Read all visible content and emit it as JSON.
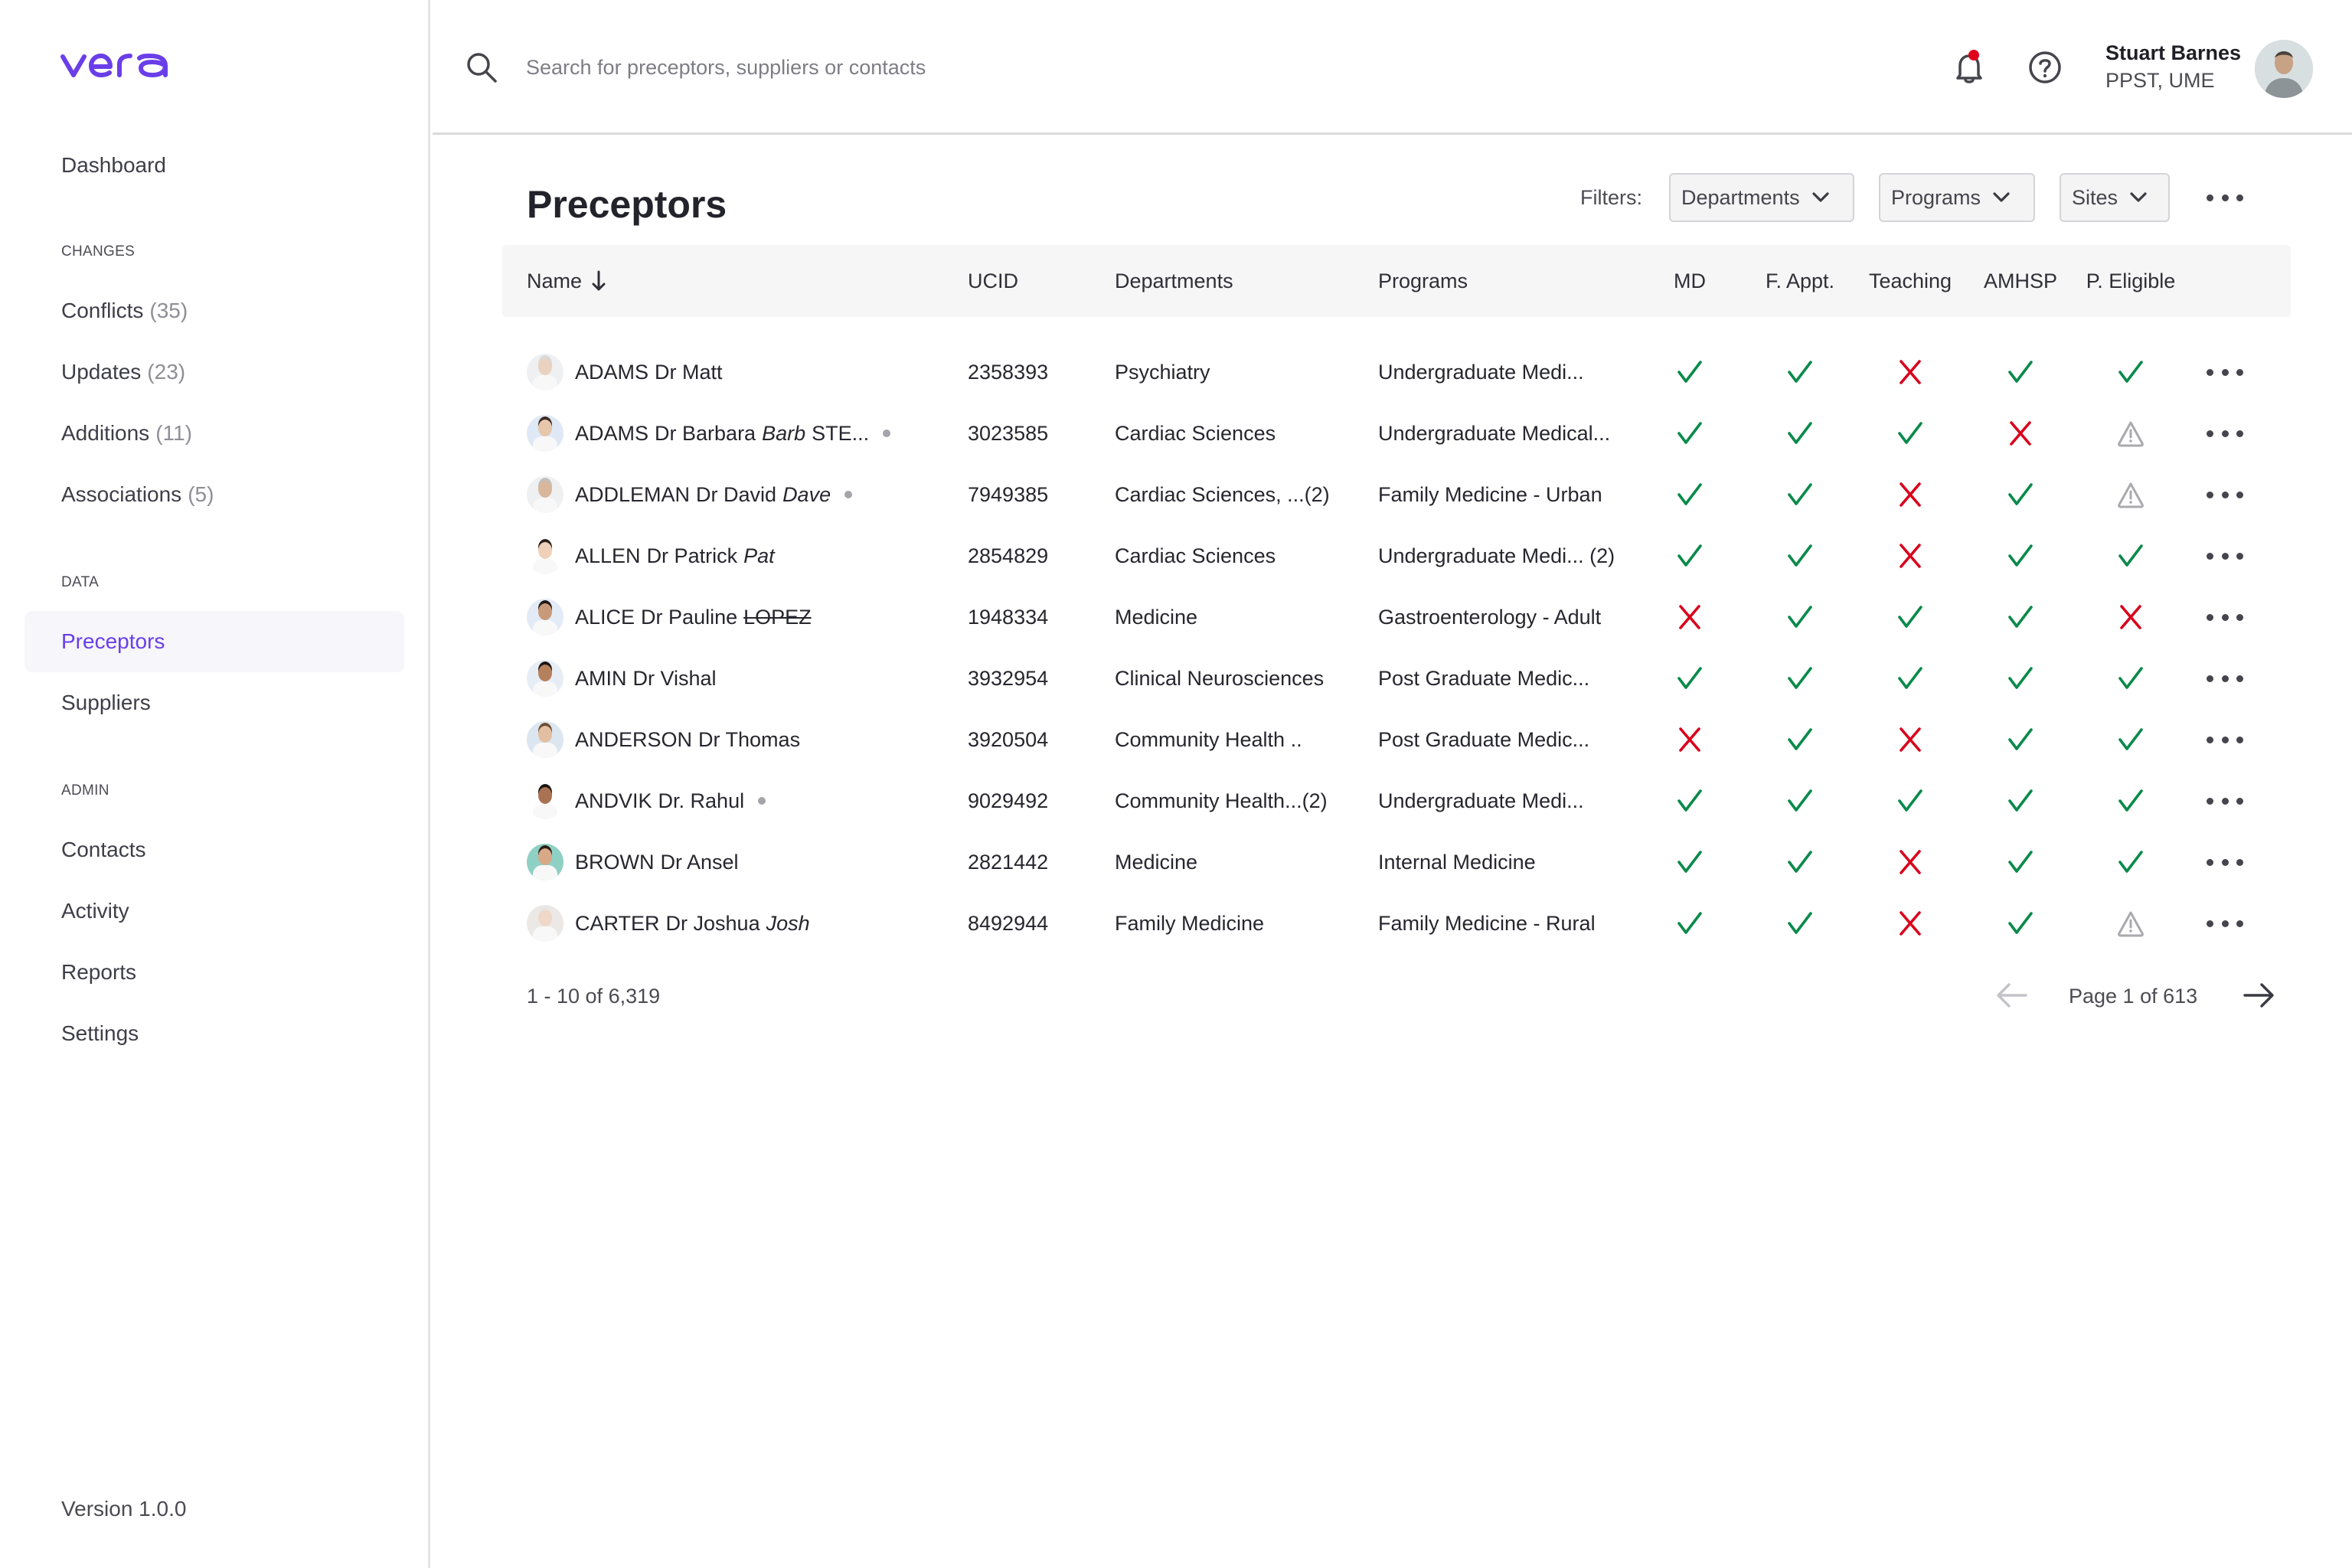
{
  "app": {
    "logo_text": "vera",
    "brand_color": "#6a3ee8",
    "version": "Version 1.0.0"
  },
  "sidebar": {
    "dashboard": "Dashboard",
    "sections": {
      "changes": "CHANGES",
      "data": "DATA",
      "admin": "ADMIN"
    },
    "changes_items": [
      {
        "label": "Conflicts",
        "count": "(35)"
      },
      {
        "label": "Updates",
        "count": "(23)"
      },
      {
        "label": "Additions",
        "count": "(11)"
      },
      {
        "label": "Associations",
        "count": "(5)"
      }
    ],
    "data_items": [
      {
        "label": "Preceptors",
        "active": true
      },
      {
        "label": "Suppliers",
        "active": false
      }
    ],
    "admin_items": [
      {
        "label": "Contacts"
      },
      {
        "label": "Activity"
      },
      {
        "label": "Reports"
      },
      {
        "label": "Settings"
      }
    ]
  },
  "header": {
    "search_placeholder": "Search for preceptors, suppliers or contacts",
    "search_value": "",
    "notification_icon": "bell-icon",
    "notification_badge_color": "#e0001b",
    "help_icon": "help-circle-icon",
    "user": {
      "name": "Stuart Barnes",
      "role": "PPST, UME"
    }
  },
  "main": {
    "title": "Preceptors",
    "filters_label": "Filters:",
    "filters": [
      {
        "label": "Departments"
      },
      {
        "label": "Programs"
      },
      {
        "label": "Sites"
      }
    ],
    "columns": {
      "name": "Name",
      "ucid": "UCID",
      "departments": "Departments",
      "programs": "Programs",
      "md": "MD",
      "f_appt": "F. Appt.",
      "teaching": "Teaching",
      "amhsp": "AMHSP",
      "p_eligible": "P. Eligible"
    },
    "sort": {
      "column": "Name",
      "direction": "descending-arrow"
    },
    "status_colors": {
      "check": "#0a8a4a",
      "cross": "#d9001b",
      "warning": "#a9a9ae"
    },
    "rows": [
      {
        "surname": "ADAMS",
        "given": "Dr Matt",
        "nickname": "",
        "struck": "",
        "extra": "",
        "dot": false,
        "ucid": "2358393",
        "department": "Psychiatry",
        "program": "Undergraduate Medi...",
        "md": "check",
        "f_appt": "check",
        "teaching": "cross",
        "amhsp": "check",
        "p_eligible": "check"
      },
      {
        "surname": "ADAMS",
        "given": "Dr Barbara",
        "nickname": "Barb",
        "struck": "",
        "extra": "STE...",
        "dot": true,
        "ucid": "3023585",
        "department": "Cardiac Sciences",
        "program": "Undergraduate Medical...",
        "md": "check",
        "f_appt": "check",
        "teaching": "check",
        "amhsp": "cross",
        "p_eligible": "warning"
      },
      {
        "surname": "ADDLEMAN",
        "given": "Dr David",
        "nickname": "Dave",
        "struck": "",
        "extra": "",
        "dot": true,
        "ucid": "7949385",
        "department": "Cardiac Sciences, ...(2)",
        "program": "Family Medicine - Urban",
        "md": "check",
        "f_appt": "check",
        "teaching": "cross",
        "amhsp": "check",
        "p_eligible": "warning"
      },
      {
        "surname": "ALLEN",
        "given": "Dr Patrick",
        "nickname": "Pat",
        "struck": "",
        "extra": "",
        "dot": false,
        "ucid": "2854829",
        "department": "Cardiac Sciences",
        "program": "Undergraduate Medi... (2)",
        "md": "check",
        "f_appt": "check",
        "teaching": "cross",
        "amhsp": "check",
        "p_eligible": "check"
      },
      {
        "surname": "ALICE",
        "given": "Dr Pauline",
        "nickname": "",
        "struck": "LOPEZ",
        "extra": "",
        "dot": false,
        "ucid": "1948334",
        "department": "Medicine",
        "program": "Gastroenterology - Adult",
        "md": "cross",
        "f_appt": "check",
        "teaching": "check",
        "amhsp": "check",
        "p_eligible": "cross"
      },
      {
        "surname": "AMIN",
        "given": "Dr Vishal",
        "nickname": "",
        "struck": "",
        "extra": "",
        "dot": false,
        "ucid": "3932954",
        "department": "Clinical Neurosciences",
        "program": "Post Graduate Medic...",
        "md": "check",
        "f_appt": "check",
        "teaching": "check",
        "amhsp": "check",
        "p_eligible": "check"
      },
      {
        "surname": "ANDERSON",
        "given": "Dr Thomas",
        "nickname": "",
        "struck": "",
        "extra": "",
        "dot": false,
        "ucid": "3920504",
        "department": "Community Health ..",
        "program": "Post Graduate Medic...",
        "md": "cross",
        "f_appt": "check",
        "teaching": "cross",
        "amhsp": "check",
        "p_eligible": "check"
      },
      {
        "surname": "ANDVIK",
        "given": "Dr. Rahul",
        "nickname": "",
        "struck": "",
        "extra": "",
        "dot": true,
        "ucid": "9029492",
        "department": "Community Health...(2)",
        "program": "Undergraduate Medi...",
        "md": "check",
        "f_appt": "check",
        "teaching": "check",
        "amhsp": "check",
        "p_eligible": "check"
      },
      {
        "surname": "BROWN",
        "given": "Dr Ansel",
        "nickname": "",
        "struck": "",
        "extra": "",
        "dot": false,
        "ucid": "2821442",
        "department": "Medicine",
        "program": "Internal Medicine",
        "md": "check",
        "f_appt": "check",
        "teaching": "cross",
        "amhsp": "check",
        "p_eligible": "check"
      },
      {
        "surname": "CARTER",
        "given": "Dr Joshua",
        "nickname": "Josh",
        "struck": "",
        "extra": "",
        "dot": false,
        "ucid": "8492944",
        "department": "Family Medicine",
        "program": "Family Medicine - Rural",
        "md": "check",
        "f_appt": "check",
        "teaching": "cross",
        "amhsp": "check",
        "p_eligible": "warning"
      }
    ],
    "footer": {
      "range": "1 - 10 of 6,319",
      "page_label": "Page 1 of 613",
      "prev_enabled": false,
      "next_enabled": true
    }
  }
}
